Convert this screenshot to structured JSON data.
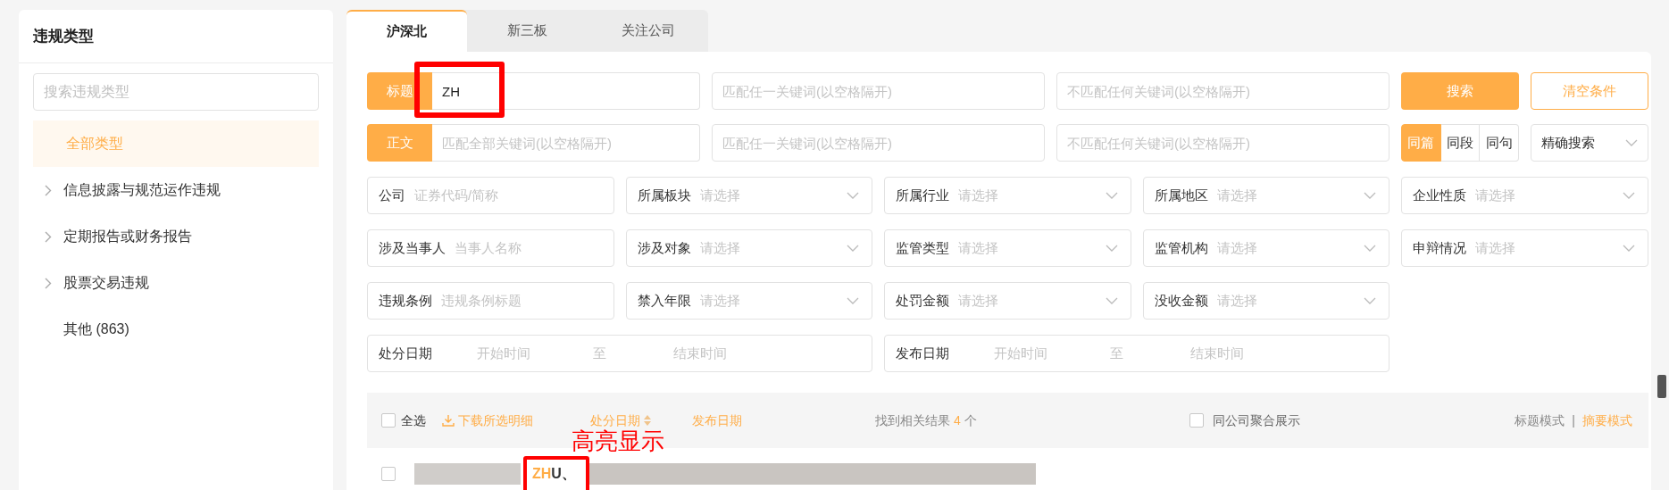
{
  "sidebar": {
    "title": "违规类型",
    "search": {
      "placeholder": "搜索违规类型"
    },
    "items": [
      {
        "label": "全部类型",
        "selected": true,
        "expandable": false
      },
      {
        "label": "信息披露与规范运作违规",
        "selected": false,
        "expandable": true
      },
      {
        "label": "定期报告或财务报告",
        "selected": false,
        "expandable": true
      },
      {
        "label": "股票交易违规",
        "selected": false,
        "expandable": true
      },
      {
        "label": "其他 (863)",
        "selected": false,
        "expandable": false
      }
    ]
  },
  "tabs": [
    {
      "label": "沪深北",
      "selected": true
    },
    {
      "label": "新三板",
      "selected": false
    },
    {
      "label": "关注公司",
      "selected": false
    }
  ],
  "keyword_rows": [
    {
      "label": "标题",
      "fields": [
        {
          "value": "ZH"
        },
        {
          "placeholder": "匹配任一关键词(以空格隔开)"
        },
        {
          "placeholder": "不匹配任何关键词(以空格隔开)"
        }
      ]
    },
    {
      "label": "正文",
      "fields": [
        {
          "placeholder": "匹配全部关键词(以空格隔开)"
        },
        {
          "placeholder": "匹配任一关键词(以空格隔开)"
        },
        {
          "placeholder": "不匹配任何关键词(以空格隔开)"
        }
      ]
    }
  ],
  "search_button": "搜索",
  "clear_button": "清空条件",
  "scope_options": [
    {
      "label": "同篇",
      "selected": true
    },
    {
      "label": "同段",
      "selected": false
    },
    {
      "label": "同句",
      "selected": false
    }
  ],
  "match_mode": "精确搜索",
  "filters": [
    {
      "kind": "text",
      "label": "公司",
      "placeholder": "证券代码/简称"
    },
    {
      "kind": "select",
      "label": "所属板块",
      "placeholder": "请选择"
    },
    {
      "kind": "select",
      "label": "所属行业",
      "placeholder": "请选择"
    },
    {
      "kind": "select",
      "label": "所属地区",
      "placeholder": "请选择"
    },
    {
      "kind": "select",
      "label": "企业性质",
      "placeholder": "请选择"
    },
    {
      "kind": "text",
      "label": "涉及当事人",
      "placeholder": "当事人名称"
    },
    {
      "kind": "select",
      "label": "涉及对象",
      "placeholder": "请选择"
    },
    {
      "kind": "select",
      "label": "监管类型",
      "placeholder": "请选择"
    },
    {
      "kind": "select",
      "label": "监管机构",
      "placeholder": "请选择"
    },
    {
      "kind": "select",
      "label": "申辩情况",
      "placeholder": "请选择"
    },
    {
      "kind": "text",
      "label": "违规条例",
      "placeholder": "违规条例标题"
    },
    {
      "kind": "select",
      "label": "禁入年限",
      "placeholder": "请选择"
    },
    {
      "kind": "select",
      "label": "处罚金额",
      "placeholder": "请选择"
    },
    {
      "kind": "select",
      "label": "没收金额",
      "placeholder": "请选择"
    },
    {
      "kind": "date_range",
      "label": "处分日期",
      "start_placeholder": "开始时间",
      "separator": "至",
      "end_placeholder": "结束时间"
    },
    {
      "kind": "date_range",
      "label": "发布日期",
      "start_placeholder": "开始时间",
      "separator": "至",
      "end_placeholder": "结束时间"
    }
  ],
  "results_bar": {
    "select_all": {
      "label": "全选",
      "checked": false
    },
    "download": "下载所选明细",
    "sort_fields": [
      {
        "label": "处分日期",
        "sort_icon": true
      },
      {
        "label": "发布日期",
        "sort_icon": false
      }
    ],
    "count": {
      "prefix": "找到相关结果",
      "value": "4",
      "suffix": "个"
    },
    "group_by_company": {
      "label": "同公司聚合展示",
      "checked": false
    },
    "view_modes": [
      {
        "label": "标题模式",
        "selected": false
      },
      {
        "label": "摘要模式",
        "selected": true
      }
    ],
    "view_separator": "|"
  },
  "results": [
    {
      "checked": false,
      "highlight": "ZH",
      "rest": "U、"
    }
  ],
  "annotation": "高亮显示"
}
